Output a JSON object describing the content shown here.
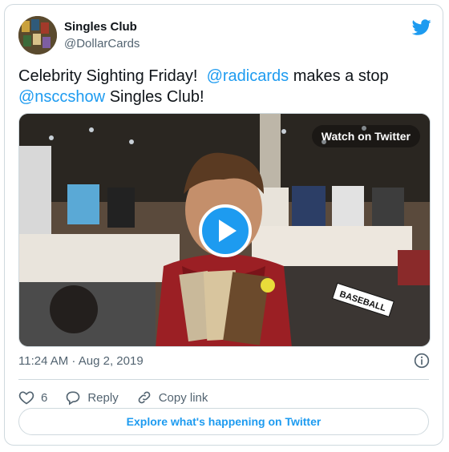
{
  "author": {
    "display_name": "Singles Club",
    "handle": "@DollarCards",
    "avatar_icon": "avatar"
  },
  "tweet": {
    "text_part1": "Celebrity Sighting Friday!",
    "mention1": "@radicards",
    "text_part2": "makes a stop",
    "mention2": "@nsccshow",
    "text_part3": "Singles Club!",
    "timestamp": "11:24 AM · Aug 2, 2019"
  },
  "media": {
    "watch_label": "Watch on Twitter",
    "sign_label": "BASEBALL",
    "play_icon": "play-icon"
  },
  "actions": {
    "like_count": "6",
    "reply_label": "Reply",
    "copy_label": "Copy link"
  },
  "footer": {
    "explore_label": "Explore what's happening on Twitter"
  },
  "colors": {
    "accent": "#1d9bf0",
    "text": "#0f1419",
    "muted": "#536471",
    "border": "#cfd9de"
  }
}
